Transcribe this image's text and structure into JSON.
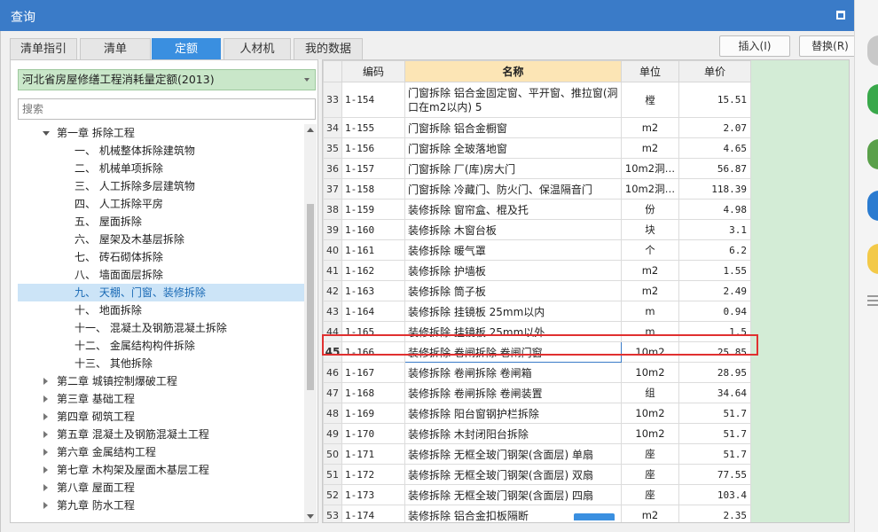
{
  "window": {
    "title": "查询"
  },
  "tabs": [
    "清单指引",
    "清单",
    "定额",
    "人材机",
    "我的数据"
  ],
  "active_tab": "定额",
  "buttons": {
    "insert": "插入(I)",
    "replace": "替换(R)"
  },
  "quota_library": "河北省房屋修缮工程消耗量定额(2013)",
  "search": {
    "placeholder": "搜索"
  },
  "tree": [
    {
      "label": "第一章 拆除工程",
      "expanded": true
    },
    {
      "label": "一、 机械整体拆除建筑物"
    },
    {
      "label": "二、 机械单项拆除"
    },
    {
      "label": "三、 人工拆除多层建筑物"
    },
    {
      "label": "四、 人工拆除平房"
    },
    {
      "label": "五、 屋面拆除"
    },
    {
      "label": "六、 屋架及木基层拆除"
    },
    {
      "label": "七、 砖石砌体拆除"
    },
    {
      "label": "八、 墙面面层拆除"
    },
    {
      "label": "九、 天棚、门窗、装修拆除",
      "selected": true
    },
    {
      "label": "十、 地面拆除"
    },
    {
      "label": "十一、 混凝土及钢筋混凝土拆除"
    },
    {
      "label": "十二、 金属结构构件拆除"
    },
    {
      "label": "十三、 其他拆除"
    },
    {
      "label": "第二章 城镇控制爆破工程"
    },
    {
      "label": "第三章 基础工程"
    },
    {
      "label": "第四章 砌筑工程"
    },
    {
      "label": "第五章 混凝土及钢筋混凝土工程"
    },
    {
      "label": "第六章 金属结构工程"
    },
    {
      "label": "第七章 木构架及屋面木基层工程"
    },
    {
      "label": "第八章 屋面工程"
    },
    {
      "label": "第九章 防水工程"
    }
  ],
  "table": {
    "headers": [
      "编码",
      "名称",
      "单位",
      "单价"
    ],
    "rows": [
      [
        "33",
        "1-154",
        "门窗拆除 铝合金固定窗、平开窗、推拉窗(洞口在m2以内) 5",
        "樘",
        "15.51"
      ],
      [
        "34",
        "1-155",
        "门窗拆除 铝合金橱窗",
        "m2",
        "2.07"
      ],
      [
        "35",
        "1-156",
        "门窗拆除 全玻落地窗",
        "m2",
        "4.65"
      ],
      [
        "36",
        "1-157",
        "门窗拆除 厂(库)房大门",
        "10m2洞…",
        "56.87"
      ],
      [
        "37",
        "1-158",
        "门窗拆除 冷藏门、防火门、保温隔音门",
        "10m2洞…",
        "118.39"
      ],
      [
        "38",
        "1-159",
        "装修拆除 窗帘盒、棍及托",
        "份",
        "4.98"
      ],
      [
        "39",
        "1-160",
        "装修拆除 木窗台板",
        "块",
        "3.1"
      ],
      [
        "40",
        "1-161",
        "装修拆除 暖气罩",
        "个",
        "6.2"
      ],
      [
        "41",
        "1-162",
        "装修拆除 护墙板",
        "m2",
        "1.55"
      ],
      [
        "42",
        "1-163",
        "装修拆除 筒子板",
        "m2",
        "2.49"
      ],
      [
        "43",
        "1-164",
        "装修拆除 挂镜板 25mm以内",
        "m",
        "0.94"
      ],
      [
        "44",
        "1-165",
        "装修拆除 挂镜板 25mm以外",
        "m",
        "1.5"
      ],
      [
        "45",
        "1-166",
        "装修拆除 卷闸拆除 卷闸门窗",
        "10m2",
        "25.85"
      ],
      [
        "46",
        "1-167",
        "装修拆除 卷闸拆除 卷闸箱",
        "10m2",
        "28.95"
      ],
      [
        "47",
        "1-168",
        "装修拆除 卷闸拆除 卷闸装置",
        "组",
        "34.64"
      ],
      [
        "48",
        "1-169",
        "装修拆除 阳台窗钢护栏拆除",
        "10m2",
        "51.7"
      ],
      [
        "49",
        "1-170",
        "装修拆除 木封闭阳台拆除",
        "10m2",
        "51.7"
      ],
      [
        "50",
        "1-171",
        "装修拆除 无框全玻门钢架(含面层) 单扇",
        "座",
        "51.7"
      ],
      [
        "51",
        "1-172",
        "装修拆除 无框全玻门钢架(含面层) 双扇",
        "座",
        "77.55"
      ],
      [
        "52",
        "1-173",
        "装修拆除 无框全玻门钢架(含面层) 四扇",
        "座",
        "103.4"
      ],
      [
        "53",
        "1-174",
        "装修拆除 铝合金扣板隔断",
        "m2",
        "2.35"
      ]
    ],
    "highlighted_row": "45"
  },
  "colors": {
    "titlebar": "#3a7bc8",
    "active_tab": "#3a8fe0",
    "highlight": "#e03030",
    "green": "#c9e7c9"
  }
}
